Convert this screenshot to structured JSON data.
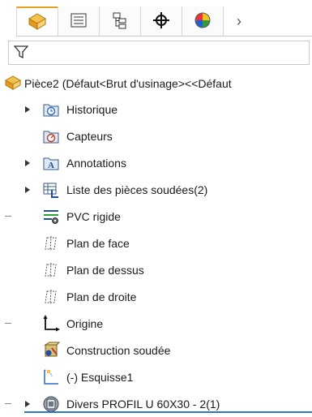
{
  "tabs": [
    {
      "id": "feature-manager",
      "icon": "feature-tree-icon"
    },
    {
      "id": "property-manager",
      "icon": "property-list-icon"
    },
    {
      "id": "configuration-manager",
      "icon": "configuration-icon"
    },
    {
      "id": "dimxpert-manager",
      "icon": "crosshair-icon"
    },
    {
      "id": "display-manager",
      "icon": "appearance-icon"
    }
  ],
  "more_tabs_glyph": "›",
  "part": {
    "label": "Pièce2  (Défaut<Brut d'usinage><<Défaut"
  },
  "tree": [
    {
      "label": "Historique",
      "icon": "history-icon",
      "expandable": true
    },
    {
      "label": "Capteurs",
      "icon": "sensor-icon",
      "expandable": false
    },
    {
      "label": "Annotations",
      "icon": "annotations-icon",
      "expandable": true
    },
    {
      "label": "Liste des pièces soudées(2)",
      "icon": "cut-list-icon",
      "expandable": true
    },
    {
      "label": "PVC rigide",
      "icon": "material-icon",
      "expandable": false
    },
    {
      "label": "Plan de face",
      "icon": "plane-icon",
      "expandable": false
    },
    {
      "label": "Plan de dessus",
      "icon": "plane-icon",
      "expandable": false
    },
    {
      "label": "Plan de droite",
      "icon": "plane-icon",
      "expandable": false
    },
    {
      "label": "Origine",
      "icon": "origin-icon",
      "expandable": false
    },
    {
      "label": "Construction soudée",
      "icon": "weldment-icon",
      "expandable": false
    },
    {
      "label": "(-) Esquisse1",
      "icon": "sketch-icon",
      "expandable": false
    },
    {
      "label": "Divers PROFIL U 60X30 - 2(1)",
      "icon": "structural-member-icon",
      "expandable": true
    }
  ],
  "colors": {
    "accent": "#e3a21a",
    "selection_line": "#2f78c9"
  }
}
